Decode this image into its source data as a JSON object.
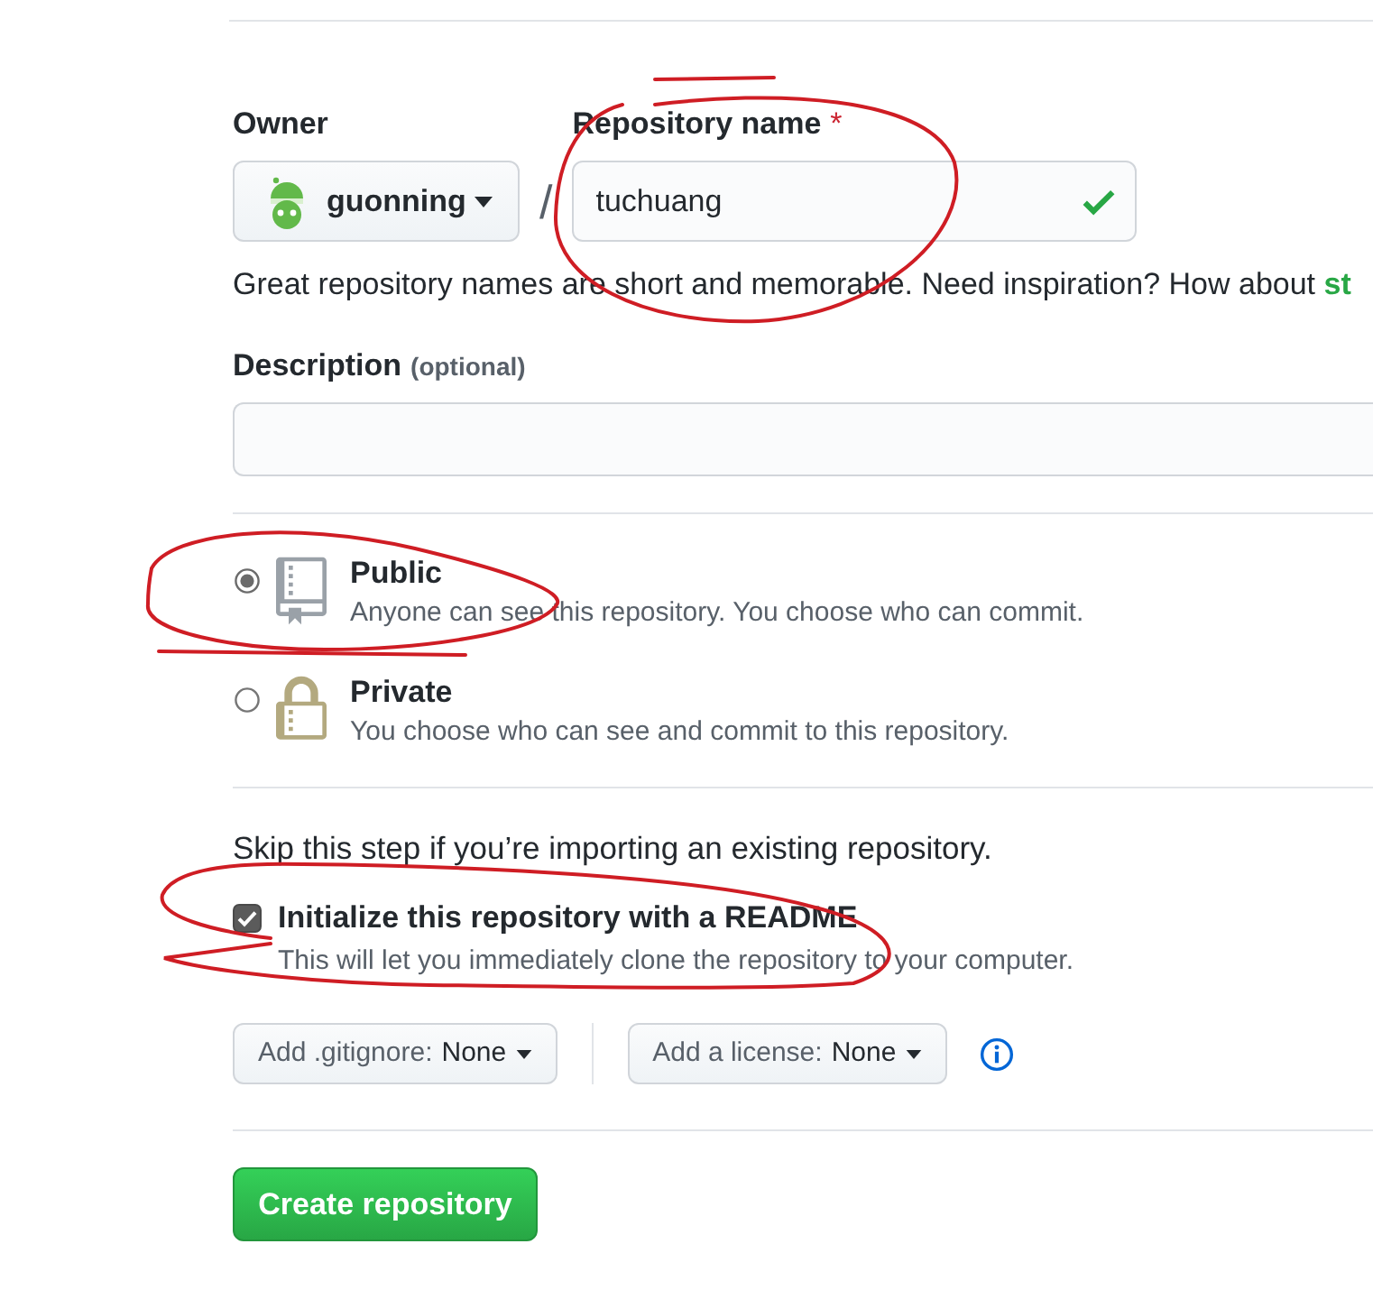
{
  "owner": {
    "label": "Owner",
    "value": "guonning"
  },
  "separator": "/",
  "repository_name": {
    "label": "Repository name",
    "required_mark": "*",
    "value": "tuchuang",
    "valid": true,
    "circled": true
  },
  "name_hint": {
    "text": "Great repository names are short and memorable. Need inspiration? How about",
    "suggestion": "st"
  },
  "description": {
    "label": "Description",
    "optional_note": "(optional)"
  },
  "visibility_options": [
    {
      "kind": "public",
      "title": "Public",
      "text": "Anyone can see this repository. You choose who can commit.",
      "selected": true,
      "circled": true
    },
    {
      "kind": "private",
      "title": "Private",
      "text": "You choose who can see and commit to this repository.",
      "selected": false,
      "circled": false
    }
  ],
  "initialize": {
    "note": "Skip this step if you’re importing an existing repository.",
    "readme": {
      "label": "Initialize this repository with a README",
      "text": "This will let you immediately clone the repository to your computer.",
      "checked": true,
      "circled": true
    }
  },
  "dropdowns": [
    {
      "label": "Add .gitignore:",
      "value": "None"
    },
    {
      "label": "Add a license:",
      "value": "None"
    }
  ],
  "submit": {
    "label": "Create repository"
  }
}
